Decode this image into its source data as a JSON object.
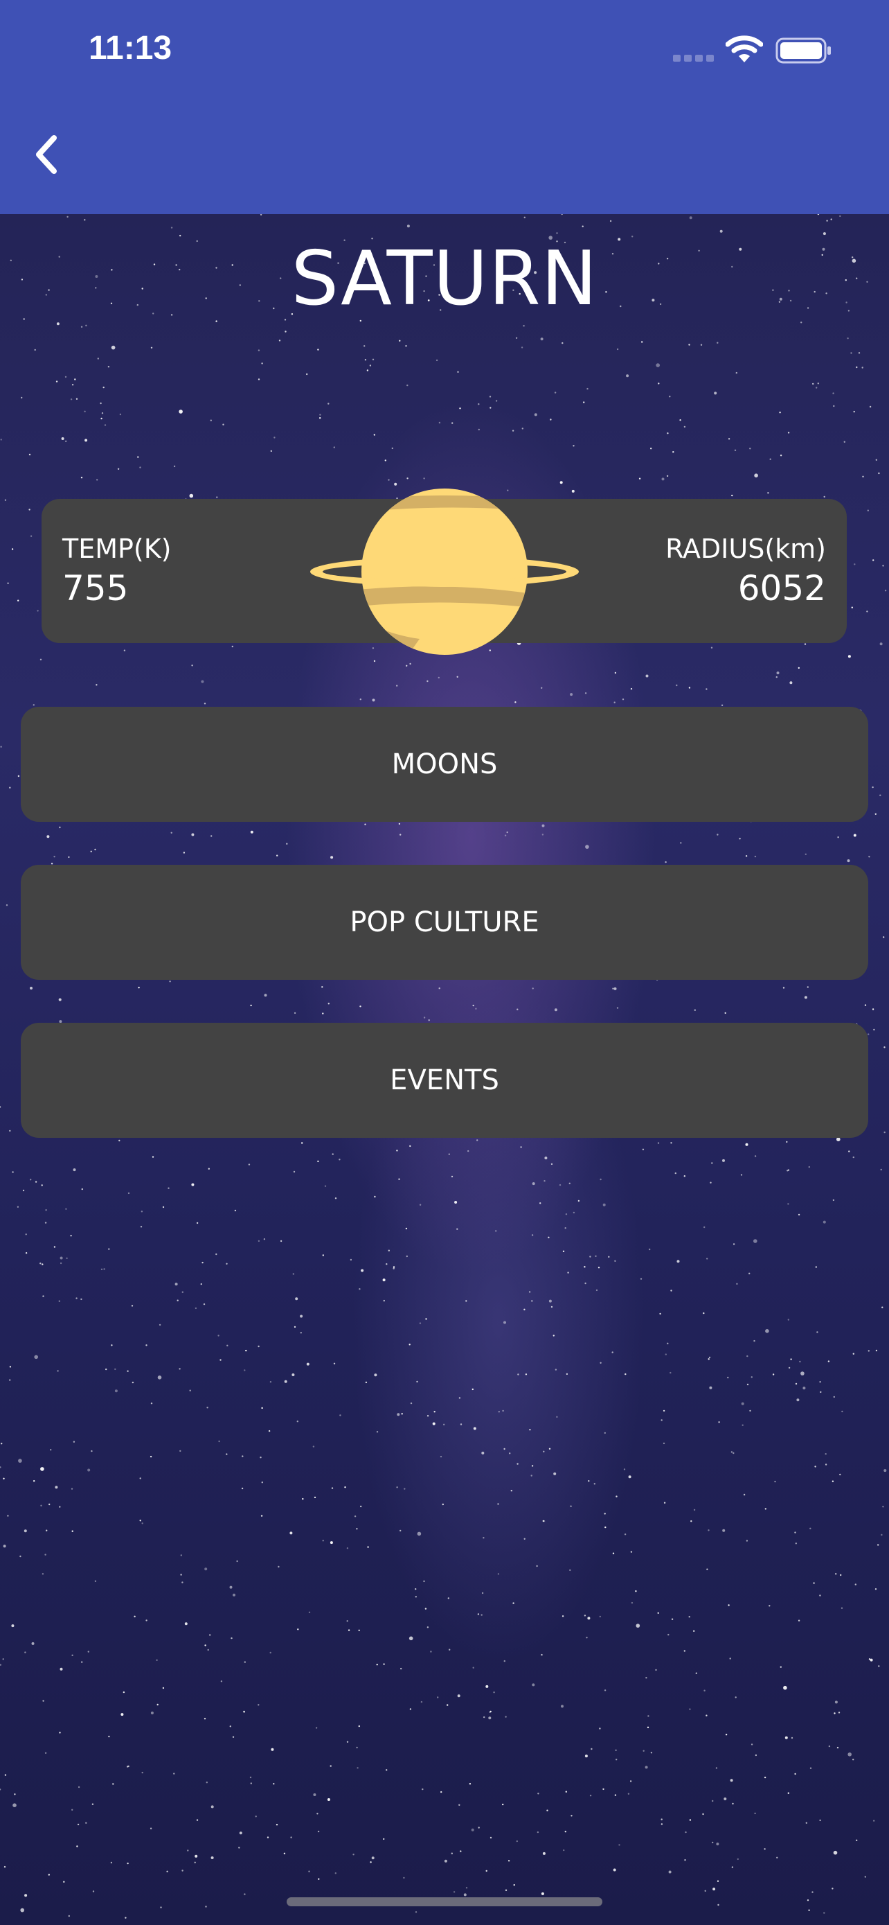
{
  "status_bar": {
    "time": "11:13",
    "icons": [
      "cellular-signal-icon",
      "wifi-icon",
      "battery-icon"
    ]
  },
  "nav": {
    "back_icon": "chevron-left-icon"
  },
  "planet": {
    "name": "SATURN",
    "icon": "saturn-planet-icon",
    "temp_label": "TEMP(K)",
    "temp_value": "755",
    "radius_label": "RADIUS(km)",
    "radius_value": "6052"
  },
  "menu": [
    {
      "label": "MOONS"
    },
    {
      "label": "POP CULTURE"
    },
    {
      "label": "EVENTS"
    }
  ],
  "colors": {
    "header": "#3f51b5",
    "card": "#434343",
    "planet": "#fed977",
    "planet_bands": "#d4b065",
    "text": "#ffffff"
  }
}
